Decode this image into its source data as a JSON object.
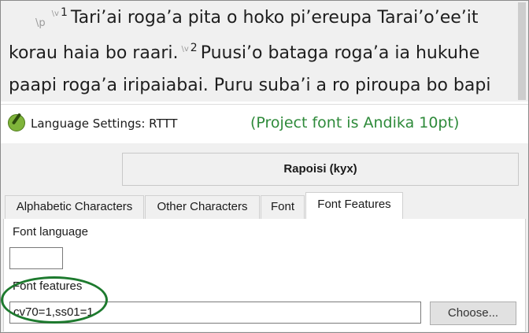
{
  "scripture": {
    "para_marker": "\\p",
    "verse_marker": "\\v",
    "verse1_number": "1",
    "verse1_text": "Tari’ai roga’a pita o hoko pi’ereupa Tarai’o’ee’it",
    "line2_text": "korau haia bo raari.",
    "verse2_number": "2",
    "verse2_text": "Puusi’o bataga roga’a ia hukuhe",
    "line3_text": "paapi roga’a iripaiabai. Puru suba’i a ro piroupa bo bapi"
  },
  "dialog": {
    "title": "Language Settings: RTTT",
    "note": "(Project font is Andika 10pt)",
    "project_button": "Rapoisi (kyx)",
    "tabs": [
      {
        "label": "Alphabetic Characters"
      },
      {
        "label": "Other Characters"
      },
      {
        "label": "Font"
      },
      {
        "label": "Font Features",
        "active": true
      }
    ],
    "font_language_label": "Font language",
    "font_language_value": "",
    "font_features_label": "Font features",
    "font_features_value": "cv70=1,ss01=1",
    "choose_button": "Choose..."
  },
  "colors": {
    "note_text": "#2e8a3a",
    "highlight_ellipse": "#1d7a2e"
  }
}
